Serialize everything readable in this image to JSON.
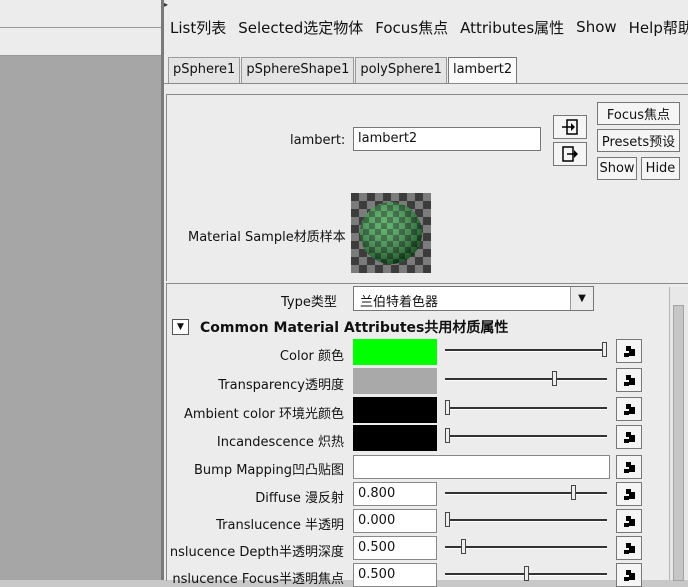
{
  "menu": [
    "List列表",
    "Selected选定物体",
    "Focus焦点",
    "Attributes属性",
    "Show",
    "Help帮助"
  ],
  "tabs": [
    "pSphere1",
    "pSphereShape1",
    "polySphere1",
    "lambert2"
  ],
  "active_tab": "lambert2",
  "node": {
    "label": "lambert:",
    "value": "lambert2"
  },
  "buttons": {
    "focus": "Focus焦点",
    "presets": "Presets预设",
    "show": "Show",
    "hide": "Hide"
  },
  "icons": {
    "input_connection": "input-connection-icon",
    "output_connection": "output-connection-icon",
    "map": "map-texture-icon",
    "collapse": "collapse-arrow-icon"
  },
  "sample": {
    "label": "Material Sample材质样本",
    "colors": {
      "green_dark": "#1f5c2a",
      "green_light": "#3fa24f",
      "grey_dark": "#3c3c3c",
      "grey_light": "#7c7c7c"
    }
  },
  "type": {
    "label": "Type类型",
    "value": "兰伯特着色器"
  },
  "section": {
    "title": "Common Material Attributes共用材质属性"
  },
  "attributes": {
    "color": {
      "label": "Color 颜色",
      "swatch": "#00ff00",
      "level": 1.0
    },
    "transparency": {
      "label": "Transparency透明度",
      "swatch": "#a9a9a9",
      "level": 0.68
    },
    "ambient": {
      "label": "Ambient color 环境光颜色",
      "swatch": "#000000",
      "level": 0.0
    },
    "incandescence": {
      "label": "Incandescence 炽热",
      "swatch": "#000000",
      "level": 0.0
    },
    "bump": {
      "label": "Bump Mapping凹凸贴图"
    },
    "diffuse": {
      "label": "Diffuse 漫反射",
      "value": "0.800",
      "level": 0.8
    },
    "translucence": {
      "label": "Translucence 半透明",
      "value": "0.000",
      "level": 0.0
    },
    "trans_depth": {
      "label": "nslucence Depth半透明深度",
      "value": "0.500",
      "level": 0.1
    },
    "trans_focus": {
      "label": "nslucence Focus半透明焦点",
      "value": "0.500",
      "level": 0.5
    }
  }
}
